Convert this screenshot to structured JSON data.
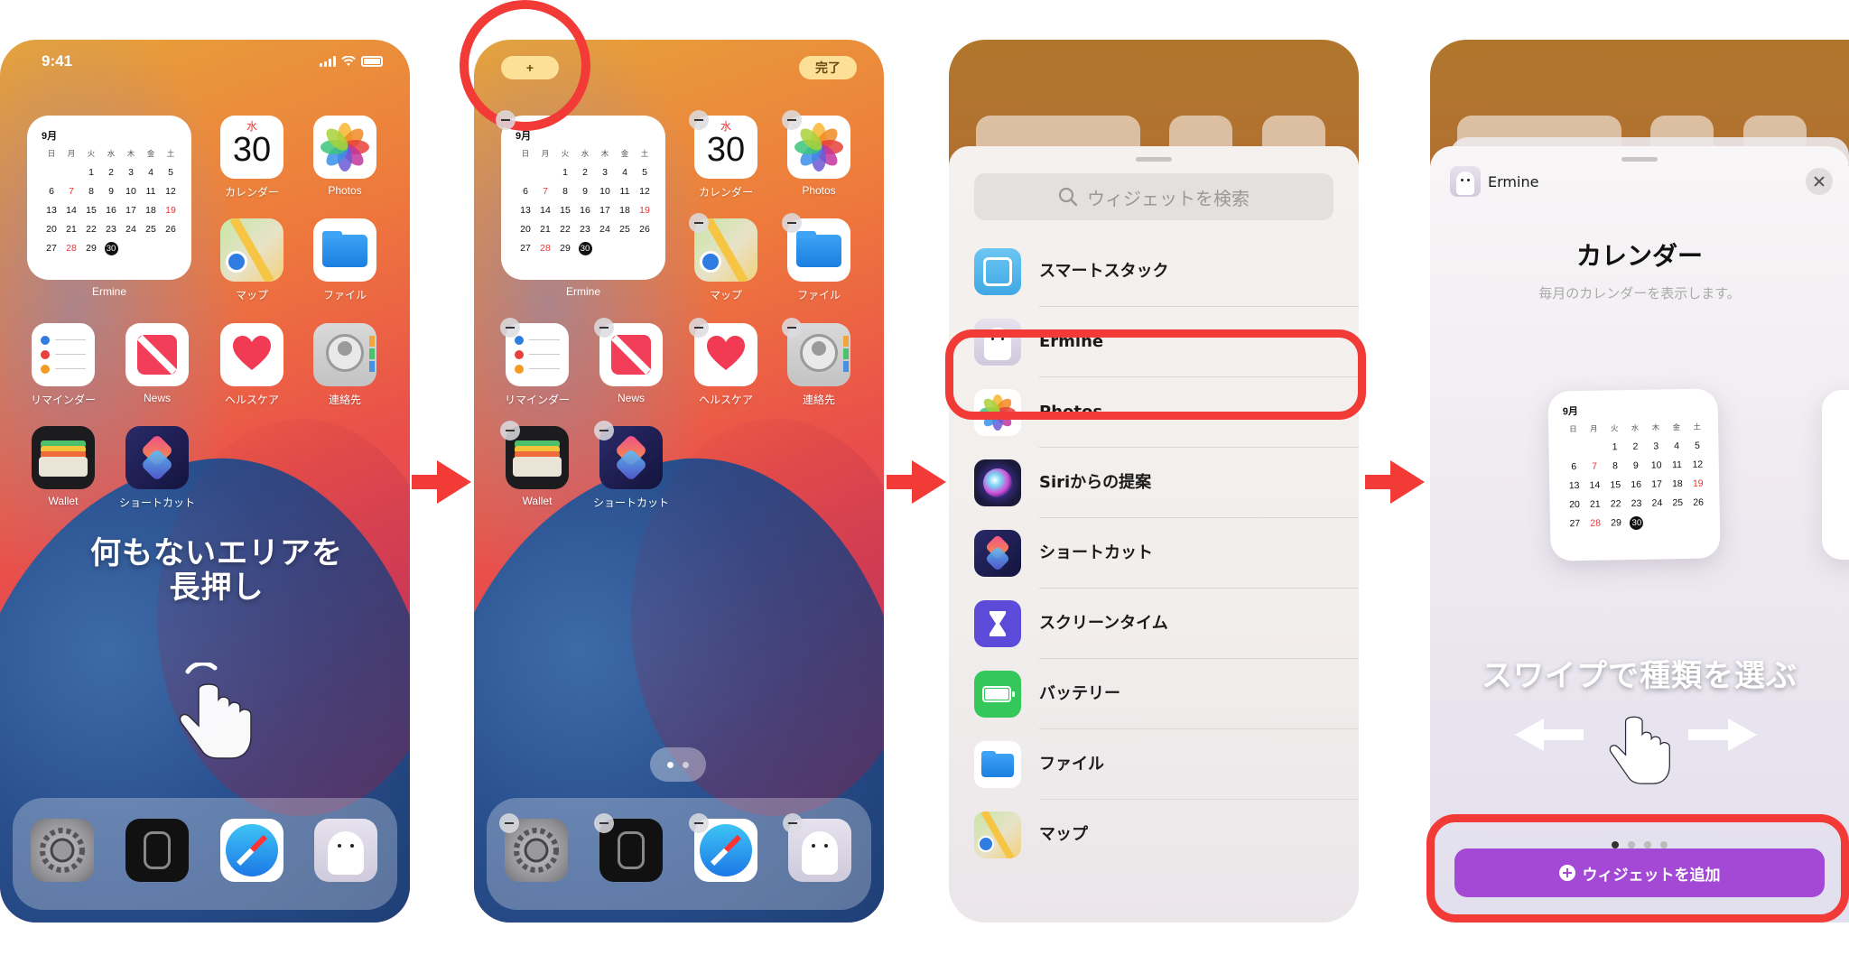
{
  "status": {
    "time": "9:41"
  },
  "apps": {
    "calendar": {
      "label": "カレンダー",
      "weekday": "水",
      "day": "30"
    },
    "photos": {
      "label": "Photos"
    },
    "maps": {
      "label": "マップ"
    },
    "files": {
      "label": "ファイル"
    },
    "reminders": {
      "label": "リマインダー"
    },
    "news": {
      "label": "News"
    },
    "health": {
      "label": "ヘルスケア"
    },
    "contacts": {
      "label": "連絡先"
    },
    "wallet": {
      "label": "Wallet"
    },
    "shortcuts": {
      "label": "ショートカット"
    }
  },
  "calendar_widget": {
    "month": "9月",
    "label": "Ermine",
    "weekdays": [
      "日",
      "月",
      "火",
      "水",
      "木",
      "金",
      "土"
    ],
    "weeks": [
      [
        "",
        "",
        "1",
        "2",
        "3",
        "4",
        "5"
      ],
      [
        "6",
        "7",
        "8",
        "9",
        "10",
        "11",
        "12"
      ],
      [
        "13",
        "14",
        "15",
        "16",
        "17",
        "18",
        "19"
      ],
      [
        "20",
        "21",
        "22",
        "23",
        "24",
        "25",
        "26"
      ],
      [
        "27",
        "28",
        "29",
        "30",
        "",
        "",
        ""
      ]
    ],
    "today": "30"
  },
  "step1": {
    "hint": "何もないエリアを\n長押し"
  },
  "step2": {
    "add_button": "+",
    "done_button": "完了"
  },
  "step3": {
    "search_placeholder": "ウィジェットを検索",
    "items": [
      "スマートスタック",
      "Ermine",
      "Photos",
      "Siriからの提案",
      "ショートカット",
      "スクリーンタイム",
      "バッテリー",
      "ファイル",
      "マップ"
    ]
  },
  "step4": {
    "app_name": "Ermine",
    "widget_title": "カレンダー",
    "widget_desc": "毎月のカレンダーを表示します。",
    "swipe_hint": "スワイプで種類を選ぶ",
    "add_button": "ウィジェットを追加"
  },
  "colors": {
    "highlight": "#f23b36",
    "accent_purple": "#a448d6"
  }
}
